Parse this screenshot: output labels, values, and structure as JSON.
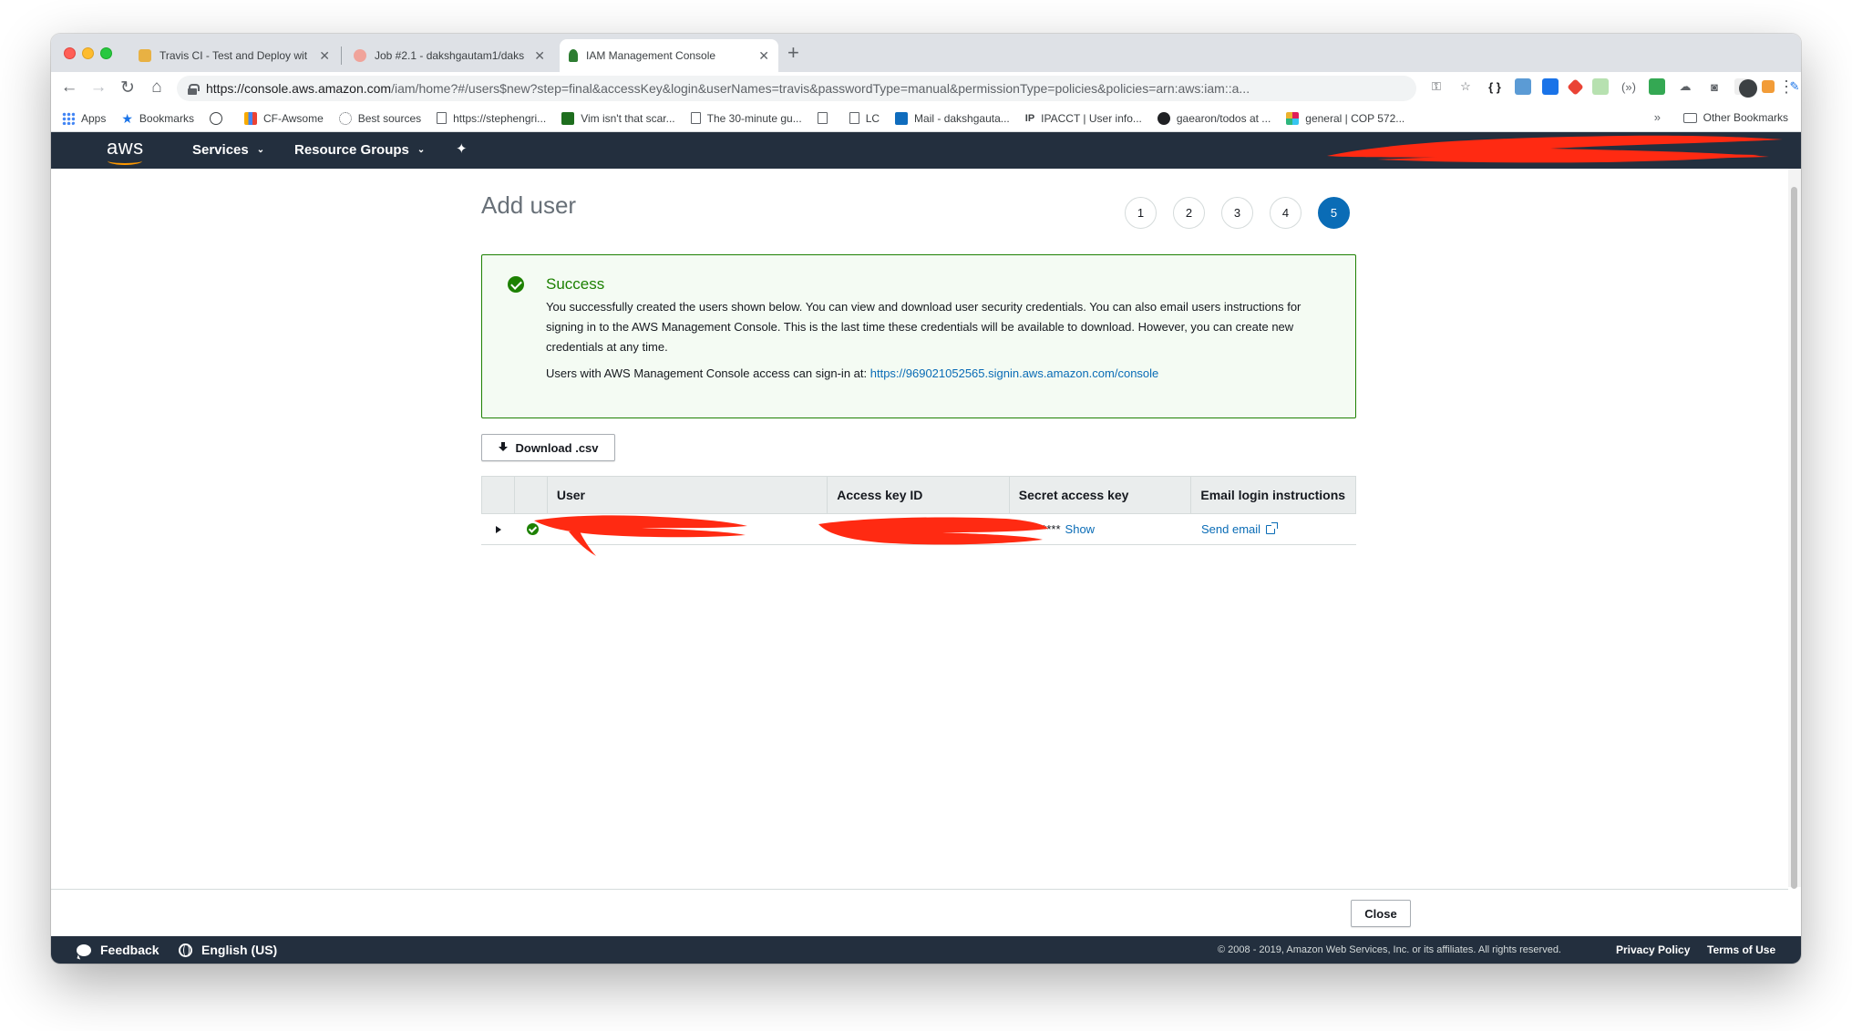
{
  "browser": {
    "tabs": [
      {
        "title": "Travis CI - Test and Deploy wit",
        "favicon_color": "#cd3d33"
      },
      {
        "title": "Job #2.1 - dakshgautam1/daks",
        "favicon_color": "#e6533a"
      },
      {
        "title": "IAM Management Console",
        "favicon_color": "#d28a1e"
      }
    ],
    "new_tab": "+",
    "url_main": "https://console.aws.amazon.com",
    "url_rest": "/iam/home?#/users$new?step=final&accessKey&login&userNames=travis&passwordType=manual&permissionType=policies&policies=arn:aws:iam::a...",
    "bookmarks": [
      {
        "label": "Apps",
        "icon_color": "#4285f4"
      },
      {
        "label": "Bookmarks",
        "icon_color": "#1a73e8"
      },
      {
        "label": "",
        "icon_color": "#3c4043"
      },
      {
        "label": "CF-Awsome",
        "icon_color": "#f9ab00"
      },
      {
        "label": "Best sources",
        "icon_color": "#5f6368"
      },
      {
        "label": "https://stephengri...",
        "icon_color": "page"
      },
      {
        "label": "Vim isn't that scar...",
        "icon_color": "#1e6e1e"
      },
      {
        "label": "The 30-minute gu...",
        "icon_color": "page"
      },
      {
        "label": "",
        "icon_color": "page"
      },
      {
        "label": "LC",
        "icon_color": "page"
      },
      {
        "label": "Mail - dakshgauta...",
        "icon_color": "#0f6cbd"
      },
      {
        "label": "IPACCT | User info...",
        "icon_color": "#202124"
      },
      {
        "label": "gaearon/todos at ...",
        "icon_color": "#202124"
      },
      {
        "label": "general | COP 572...",
        "icon_color": "#e01e5a"
      }
    ],
    "bookmarks_more": "»",
    "other_bookmarks": "Other Bookmarks"
  },
  "aws_nav": {
    "logo": "aws",
    "services": "Services",
    "resource_groups": "Resource Groups"
  },
  "page": {
    "title": "Add user",
    "steps": [
      "1",
      "2",
      "3",
      "4",
      "5"
    ],
    "current_step": 5
  },
  "alert": {
    "title": "Success",
    "body": "You successfully created the users shown below. You can view and download user security credentials. You can also email users instructions for signing in to the AWS Management Console. This is the last time these credentials will be available to download. However, you can create new credentials at any time.",
    "signin_prefix": "Users with AWS Management Console access can sign-in at: ",
    "signin_url": "https://969021052565.signin.aws.amazon.com/console"
  },
  "download_button": "Download .csv",
  "table": {
    "columns": [
      "",
      "",
      "User",
      "Access key ID",
      "Secret access key",
      "Email login instructions"
    ],
    "row": {
      "secret_mask": "*********",
      "show_link": "Show",
      "email_link": "Send email"
    }
  },
  "close_button": "Close",
  "footer": {
    "feedback": "Feedback",
    "language": "English (US)",
    "copyright": "© 2008 - 2019, Amazon Web Services, Inc. or its affiliates. All rights reserved.",
    "privacy": "Privacy Policy",
    "terms": "Terms of Use"
  },
  "colors": {
    "aws_navy": "#232f3e",
    "aws_orange": "#ff9900",
    "success_green": "#1d8102",
    "link_blue": "#0a6cb6",
    "redaction_red": "#ff2a12"
  }
}
